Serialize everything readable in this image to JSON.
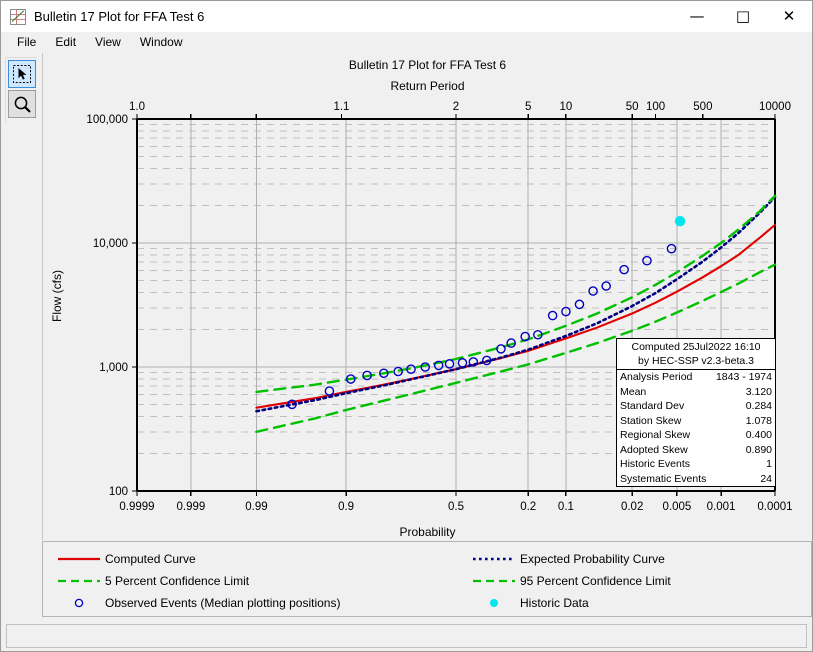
{
  "window": {
    "title": "Bulletin 17 Plot for FFA Test 6",
    "icon": "chart-icon",
    "controls": [
      {
        "name": "minimize-button",
        "glyph": "—"
      },
      {
        "name": "maximize-button",
        "glyph": "□"
      },
      {
        "name": "close-button",
        "glyph": "✕"
      }
    ]
  },
  "menubar": {
    "items": [
      {
        "label": "File"
      },
      {
        "label": "Edit"
      },
      {
        "label": "View"
      },
      {
        "label": "Window"
      }
    ]
  },
  "toolbar": {
    "tools": [
      {
        "name": "select-tool",
        "icon": "cursor-arrow-icon",
        "selected": true
      },
      {
        "name": "zoom-tool",
        "icon": "magnifier-icon",
        "selected": false
      }
    ]
  },
  "stats": {
    "computed_line": "Computed 25Jul2022 16:10",
    "by_line": "by HEC-SSP v2.3-beta.3",
    "rows": [
      {
        "label": "Analysis Period",
        "value": "1843 - 1974"
      },
      {
        "label": "Mean",
        "value": "3.120"
      },
      {
        "label": "Standard Dev",
        "value": "0.284"
      },
      {
        "label": "Station Skew",
        "value": "1.078"
      },
      {
        "label": "Regional Skew",
        "value": "0.400"
      },
      {
        "label": "Adopted Skew",
        "value": "0.890"
      },
      {
        "label": "Historic Events",
        "value": "1"
      },
      {
        "label": "Systematic Events",
        "value": "24"
      }
    ]
  },
  "legend": {
    "left": [
      {
        "label": "Computed Curve",
        "symbol": "solid-line",
        "color": "#e00000"
      },
      {
        "label": "5 Percent Confidence Limit",
        "symbol": "dashed-line",
        "color": "#00c000"
      },
      {
        "label": "Observed Events (Median plotting positions)",
        "symbol": "open-circle",
        "color": "#0000c0"
      }
    ],
    "right": [
      {
        "label": "Expected Probability Curve",
        "symbol": "dotted-line",
        "color": "#000080"
      },
      {
        "label": "95 Percent Confidence Limit",
        "symbol": "dashed-line",
        "color": "#00c000"
      },
      {
        "label": "Historic Data",
        "symbol": "filled-circle",
        "color": "#00e5ee"
      }
    ]
  },
  "chart_data": {
    "type": "line",
    "title": "Bulletin 17 Plot for FFA Test 6",
    "xlabel_top": "Return Period",
    "xlabel_bottom": "Probability",
    "ylabel": "Flow (cfs)",
    "grid": true,
    "legend_position": "bottom",
    "yscale": "log",
    "ylim": [
      100,
      100000
    ],
    "yticks": [
      100,
      1000,
      10000,
      100000
    ],
    "ytick_labels": [
      "100",
      "1,000",
      "10,000",
      "100,000"
    ],
    "xscale": "normal-probability",
    "xticks_bottom": [
      0.9999,
      0.999,
      0.99,
      0.9,
      0.5,
      0.2,
      0.1,
      0.02,
      0.005,
      0.001,
      0.0001
    ],
    "xtick_labels_bottom": [
      "0.9999",
      "0.999",
      "0.99",
      "0.9",
      "0.5",
      "0.2",
      "0.1",
      "0.02",
      "0.005",
      "0.001",
      "0.0001"
    ],
    "xticks_top_return_period": [
      1.0001,
      1.001,
      1.01,
      1.1,
      2,
      5,
      10,
      50,
      100,
      500,
      10000
    ],
    "xtick_labels_top": [
      "1.0",
      "",
      "",
      "1.1",
      "2",
      "5",
      "10",
      "50",
      "100",
      "500",
      "10000"
    ],
    "series": [
      {
        "name": "Computed Curve",
        "style": "solid",
        "color": "#e00000",
        "points": [
          [
            0.99,
            470
          ],
          [
            0.95,
            560
          ],
          [
            0.9,
            630
          ],
          [
            0.8,
            720
          ],
          [
            0.7,
            800
          ],
          [
            0.5,
            960
          ],
          [
            0.3,
            1180
          ],
          [
            0.2,
            1350
          ],
          [
            0.1,
            1700
          ],
          [
            0.05,
            2080
          ],
          [
            0.02,
            2700
          ],
          [
            0.01,
            3300
          ],
          [
            0.005,
            4050
          ],
          [
            0.002,
            5300
          ],
          [
            0.001,
            6500
          ],
          [
            0.0005,
            8000
          ],
          [
            0.0002,
            11000
          ],
          [
            0.0001,
            14000
          ]
        ]
      },
      {
        "name": "Expected Probability Curve",
        "style": "dotted",
        "color": "#000080",
        "points": [
          [
            0.99,
            440
          ],
          [
            0.95,
            540
          ],
          [
            0.9,
            615
          ],
          [
            0.8,
            710
          ],
          [
            0.7,
            795
          ],
          [
            0.5,
            960
          ],
          [
            0.3,
            1190
          ],
          [
            0.2,
            1380
          ],
          [
            0.1,
            1780
          ],
          [
            0.05,
            2250
          ],
          [
            0.02,
            3100
          ],
          [
            0.01,
            3950
          ],
          [
            0.005,
            5100
          ],
          [
            0.002,
            7100
          ],
          [
            0.001,
            9200
          ],
          [
            0.0005,
            12000
          ],
          [
            0.0002,
            17500
          ],
          [
            0.0001,
            23500
          ]
        ]
      },
      {
        "name": "5 Percent Confidence Limit",
        "style": "dashed",
        "color": "#00c000",
        "points": [
          [
            0.99,
            630
          ],
          [
            0.95,
            720
          ],
          [
            0.9,
            790
          ],
          [
            0.8,
            890
          ],
          [
            0.7,
            975
          ],
          [
            0.5,
            1160
          ],
          [
            0.3,
            1440
          ],
          [
            0.2,
            1670
          ],
          [
            0.1,
            2150
          ],
          [
            0.05,
            2700
          ],
          [
            0.02,
            3650
          ],
          [
            0.01,
            4600
          ],
          [
            0.005,
            5800
          ],
          [
            0.002,
            7900
          ],
          [
            0.001,
            10000
          ],
          [
            0.0005,
            12800
          ],
          [
            0.0002,
            18000
          ],
          [
            0.0001,
            24000
          ]
        ]
      },
      {
        "name": "95 Percent Confidence Limit",
        "style": "dashed",
        "color": "#00c000",
        "points": [
          [
            0.99,
            300
          ],
          [
            0.95,
            385
          ],
          [
            0.9,
            450
          ],
          [
            0.8,
            535
          ],
          [
            0.7,
            605
          ],
          [
            0.5,
            745
          ],
          [
            0.3,
            920
          ],
          [
            0.2,
            1050
          ],
          [
            0.1,
            1300
          ],
          [
            0.05,
            1560
          ],
          [
            0.02,
            1960
          ],
          [
            0.01,
            2320
          ],
          [
            0.005,
            2750
          ],
          [
            0.002,
            3420
          ],
          [
            0.001,
            4020
          ],
          [
            0.0005,
            4700
          ],
          [
            0.0002,
            5800
          ],
          [
            0.0001,
            6700
          ]
        ]
      },
      {
        "name": "Observed Events (Median plotting positions)",
        "style": "open-circle",
        "color": "#0000c0",
        "points": [
          [
            0.972,
            500
          ],
          [
            0.93,
            640
          ],
          [
            0.89,
            800
          ],
          [
            0.85,
            855
          ],
          [
            0.8,
            890
          ],
          [
            0.75,
            920
          ],
          [
            0.7,
            960
          ],
          [
            0.64,
            1000
          ],
          [
            0.58,
            1030
          ],
          [
            0.53,
            1060
          ],
          [
            0.47,
            1080
          ],
          [
            0.42,
            1100
          ],
          [
            0.36,
            1130
          ],
          [
            0.3,
            1400
          ],
          [
            0.26,
            1560
          ],
          [
            0.21,
            1760
          ],
          [
            0.17,
            1820
          ],
          [
            0.13,
            2600
          ],
          [
            0.1,
            2800
          ],
          [
            0.075,
            3200
          ],
          [
            0.055,
            4100
          ],
          [
            0.04,
            4500
          ],
          [
            0.025,
            6100
          ],
          [
            0.013,
            7200
          ],
          [
            0.006,
            9000
          ]
        ]
      },
      {
        "name": "Historic Data",
        "style": "filled-circle",
        "color": "#00e5ee",
        "points": [
          [
            0.0045,
            15000
          ]
        ]
      }
    ]
  }
}
